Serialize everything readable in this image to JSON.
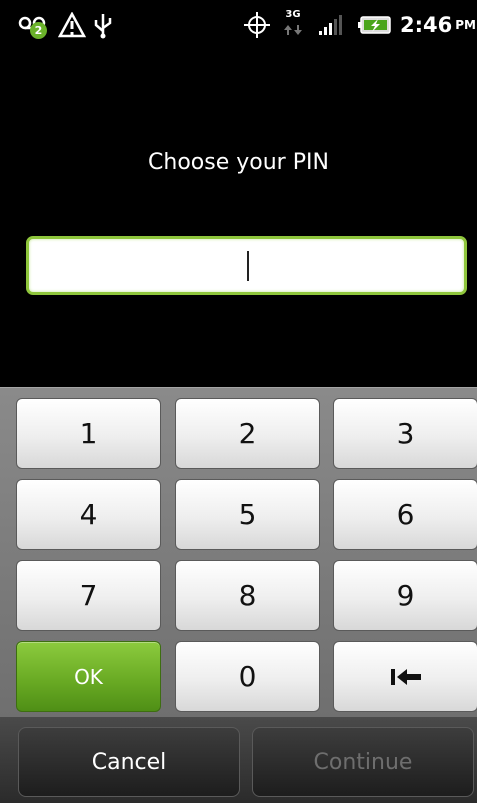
{
  "status_bar": {
    "notification_count": "2",
    "network_type": "3G",
    "time": "2:46",
    "ampm": "PM",
    "icons": {
      "voicemail": "voicemail-icon",
      "alert": "warning-icon",
      "usb": "usb-icon",
      "gps": "gps-icon",
      "signal": "signal-strength-icon",
      "battery": "battery-charging-icon"
    }
  },
  "pin": {
    "title": "Choose your PIN",
    "value": ""
  },
  "keypad": {
    "keys": [
      "1",
      "2",
      "3",
      "4",
      "5",
      "6",
      "7",
      "8",
      "9",
      "OK",
      "0"
    ],
    "backspace_icon": "backspace-icon",
    "ok_color": "#6aab24"
  },
  "actions": {
    "cancel": "Cancel",
    "continue": "Continue"
  }
}
